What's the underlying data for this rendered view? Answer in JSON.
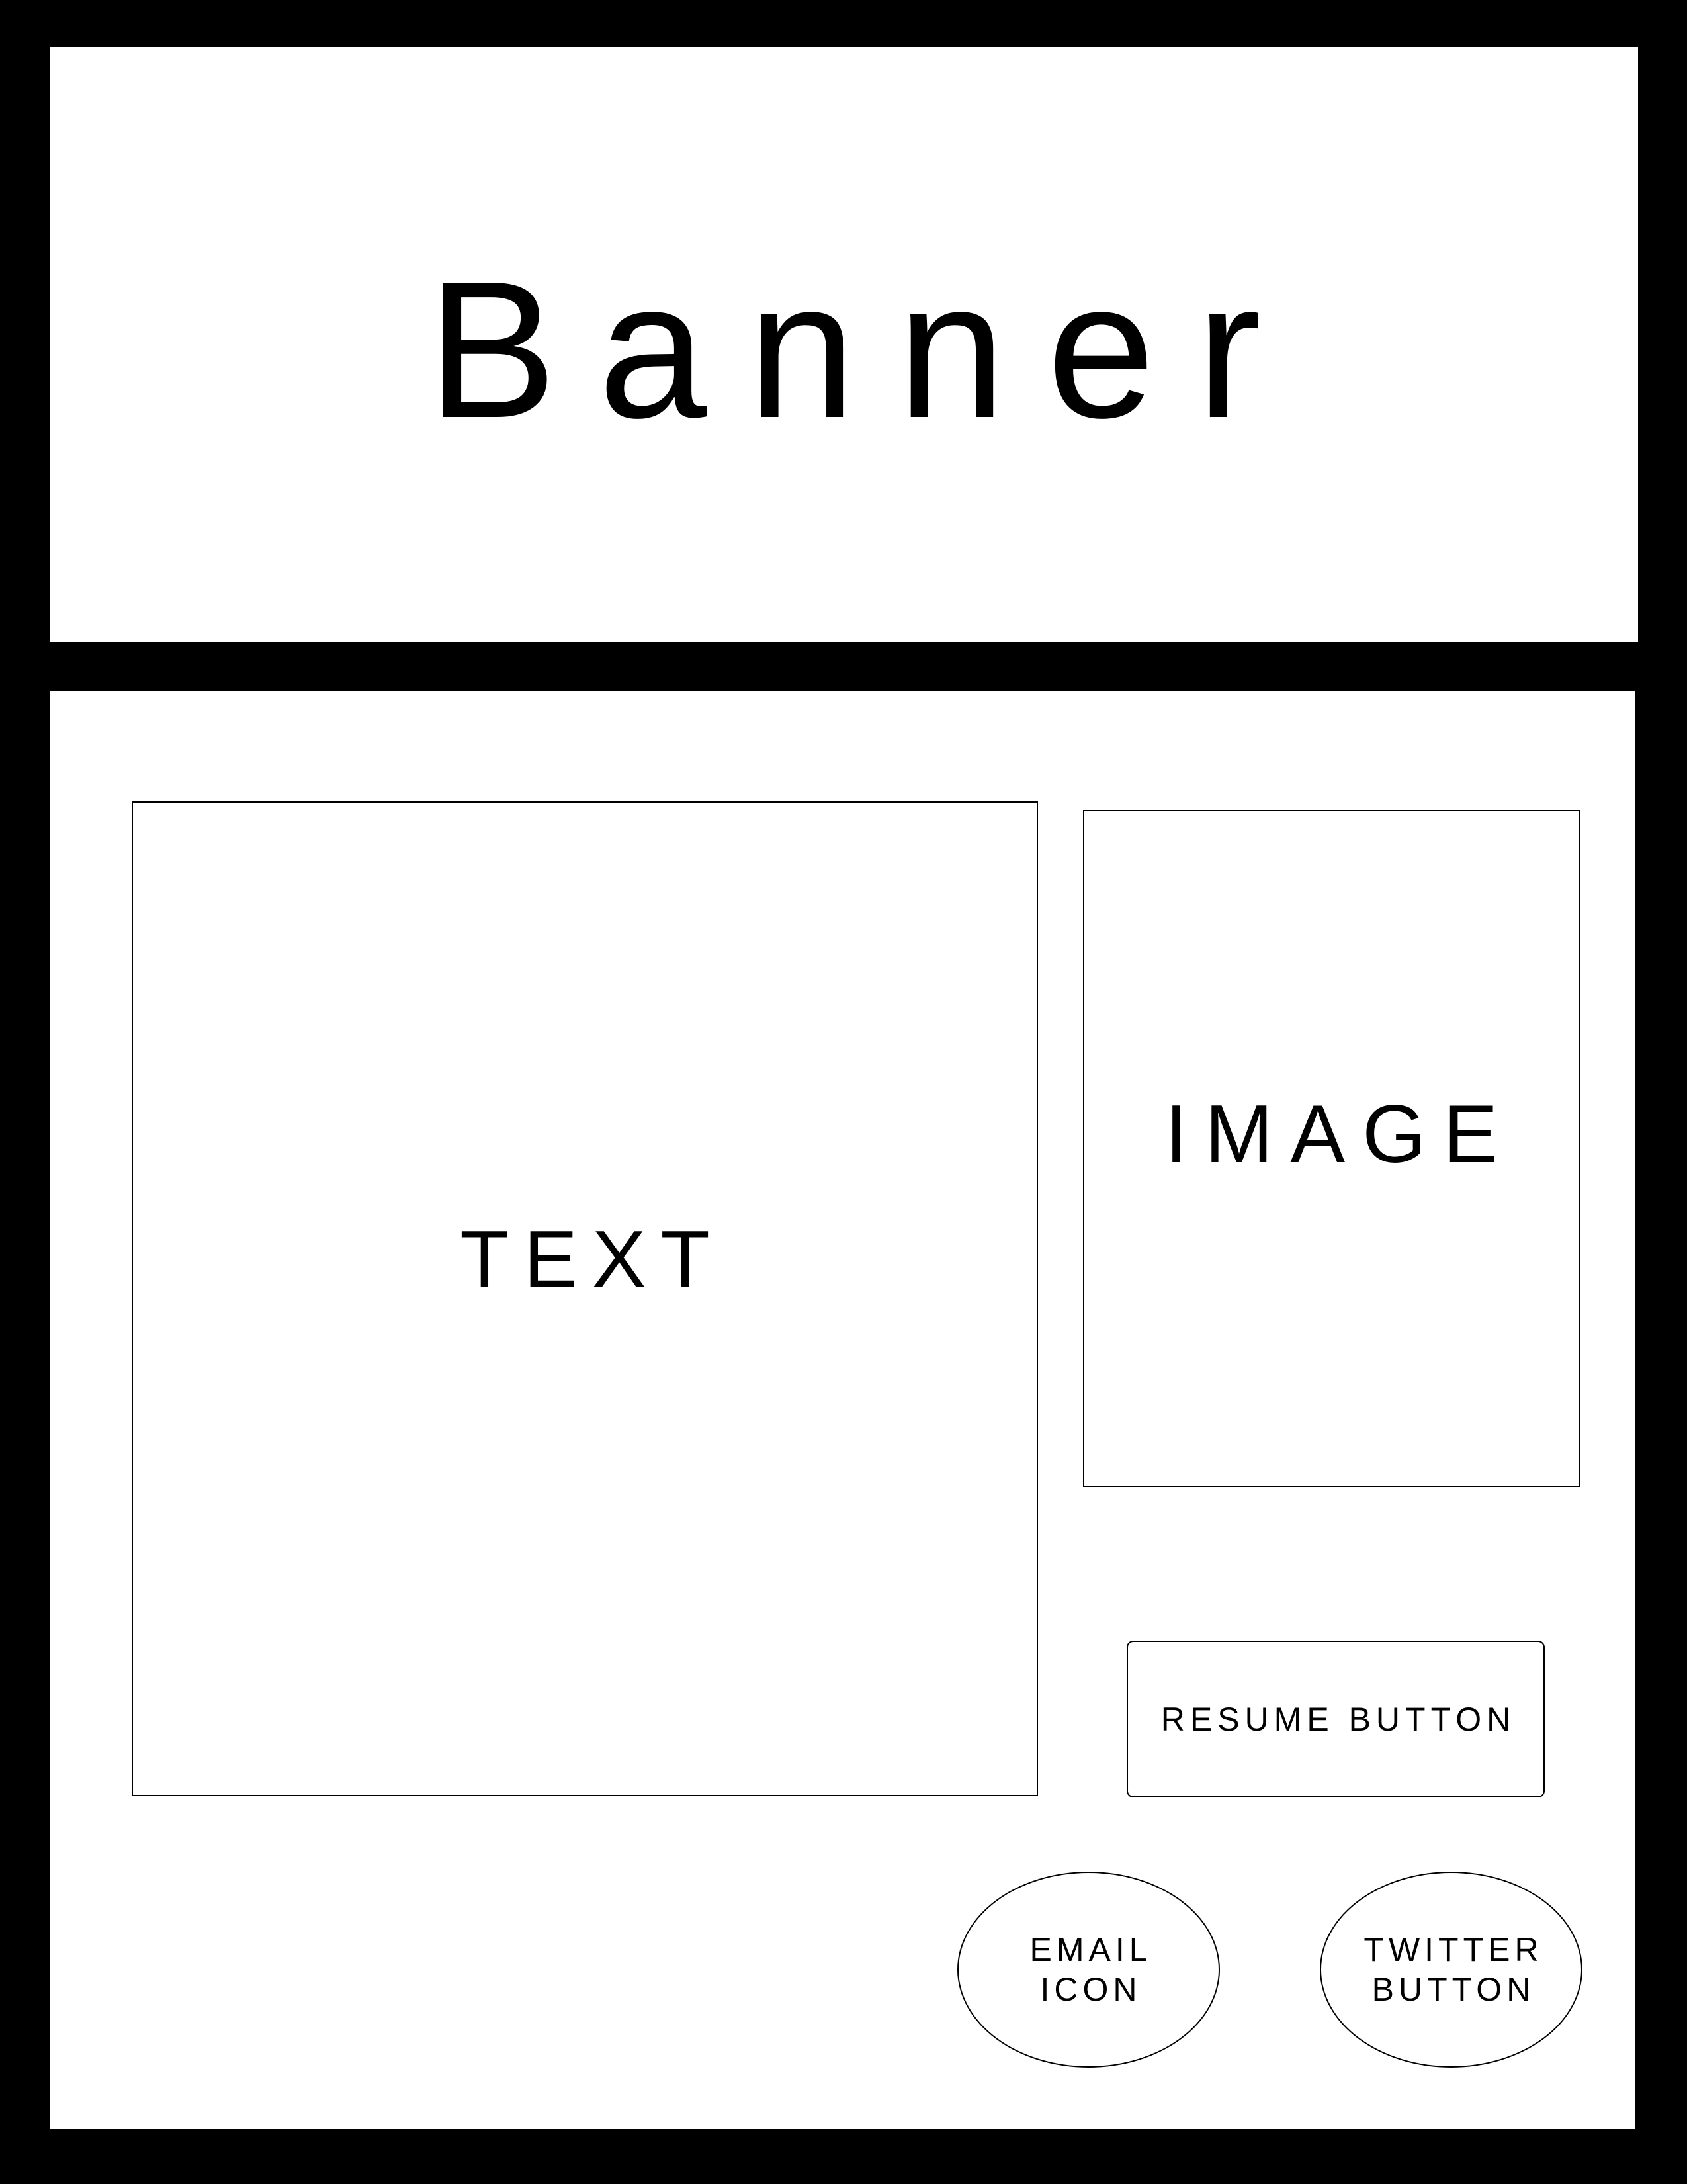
{
  "banner": {
    "title": "Banner"
  },
  "main": {
    "text_block": {
      "label": "TEXT"
    },
    "image_block": {
      "label": "IMAGE"
    },
    "resume_button": {
      "label": "RESUME BUTTON"
    },
    "email_icon": {
      "line1": "EMAIL",
      "line2": "ICON"
    },
    "twitter_button": {
      "line1": "TWITTER",
      "line2": "BUTTON"
    }
  },
  "colors": {
    "background": "#000000",
    "panel": "#ffffff",
    "outline": "#000000"
  }
}
